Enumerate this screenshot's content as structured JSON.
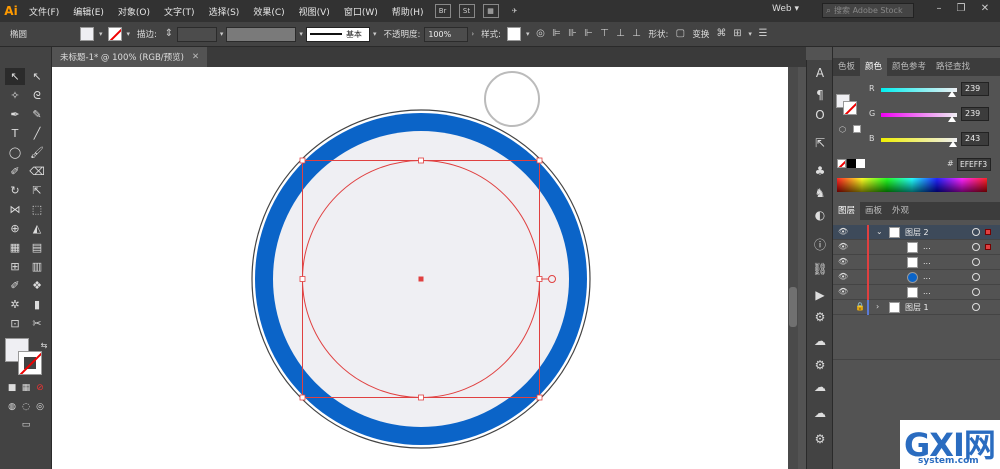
{
  "app": {
    "logo": "Ai"
  },
  "menu": {
    "items": [
      "文件(F)",
      "编辑(E)",
      "对象(O)",
      "文字(T)",
      "选择(S)",
      "效果(C)",
      "视图(V)",
      "窗口(W)",
      "帮助(H)"
    ],
    "bridge": "Br",
    "stock": "St",
    "workspace": "Web",
    "search_placeholder": "搜索 Adobe Stock"
  },
  "control": {
    "object_label": "椭圆",
    "stroke_label": "描边:",
    "stroke_style": "基本",
    "opacity_label": "不透明度:",
    "opacity_value": "100%",
    "style_label": "样式:",
    "shape_label": "形状:",
    "transform_label": "变换"
  },
  "document": {
    "tab_title": "未标题-1* @ 100% (RGB/预览)"
  },
  "color_panel": {
    "tabs": [
      "色板",
      "颜色",
      "颜色参考",
      "路径查找"
    ],
    "active_tab": "颜色",
    "channels": [
      {
        "label": "R",
        "value": "239",
        "level": 0.937
      },
      {
        "label": "G",
        "value": "239",
        "level": 0.937
      },
      {
        "label": "B",
        "value": "243",
        "level": 0.953
      }
    ],
    "hex_prefix": "#",
    "hex": "EFEFF3"
  },
  "layers_panel": {
    "tabs": [
      "图层",
      "画板",
      "外观"
    ],
    "active_tab": "图层",
    "rows": [
      {
        "name": "图层 2",
        "type": "layer",
        "expanded": true,
        "selected": true,
        "indent": 0
      },
      {
        "name": "...",
        "type": "path",
        "indent": 1
      },
      {
        "name": "...",
        "type": "path",
        "indent": 1
      },
      {
        "name": "...",
        "type": "blue-circle",
        "indent": 1
      },
      {
        "name": "...",
        "type": "path",
        "indent": 1
      },
      {
        "name": "图层 1",
        "type": "layer",
        "expanded": false,
        "locked": true,
        "indent": 0
      }
    ]
  },
  "colors": {
    "accent_blue": "#0b64c8",
    "fill_lavender": "#efeff3",
    "selection_red": "#e04040"
  },
  "watermark": {
    "brand": "GXI网",
    "domain": "system.com"
  }
}
